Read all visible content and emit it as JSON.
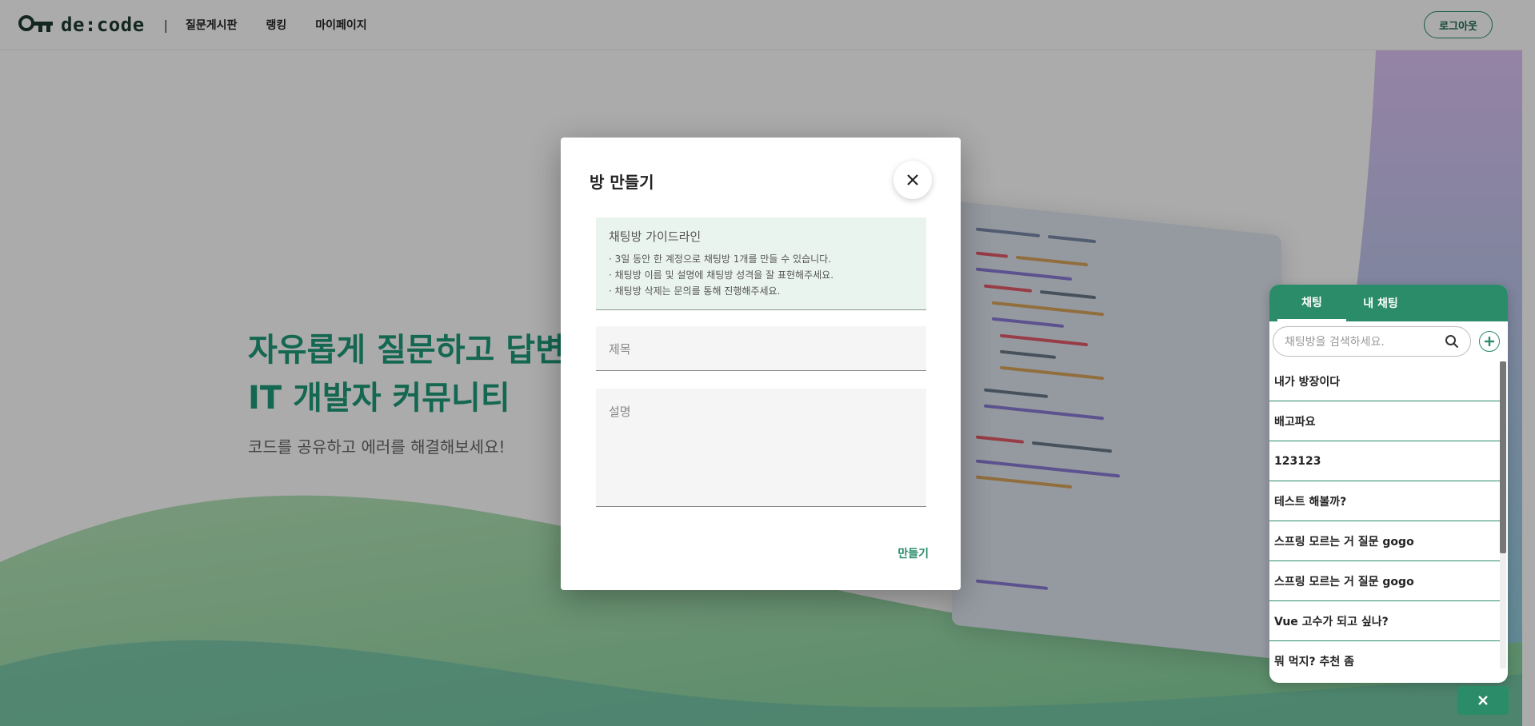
{
  "header": {
    "logo_text": "de:code",
    "nav": [
      "질문게시판",
      "랭킹",
      "마이페이지"
    ],
    "logout_label": "로그아웃"
  },
  "hero": {
    "title_line1": "자유롭게 질문하고 답변",
    "title_line2": "IT 개발자 커뮤니티",
    "subtitle": "코드를 공유하고 에러를 해결해보세요!"
  },
  "modal": {
    "title": "방 만들기",
    "guide_title": "채팅방 가이드라인",
    "guide_lines": [
      "· 3일 동안 한 계정으로 채팅방 1개를 만들 수 있습니다.",
      "· 채팅방 이름 및 설명에 채팅방 성격을 잘 표현해주세요.",
      "· 채팅방 삭제는 문의를 통해 진행해주세요."
    ],
    "title_placeholder": "제목",
    "desc_placeholder": "설명",
    "create_label": "만들기"
  },
  "chat": {
    "tabs": [
      "채팅",
      "내 채팅"
    ],
    "search_placeholder": "채팅방을 검색하세요.",
    "rooms": [
      "내가 방장이다",
      "배고파요",
      "123123",
      "테스트 해볼까?",
      "스프링 모르는 거 질문 gogo",
      "스프링 모르는 거 질문 gogo",
      "Vue 고수가 되고 싶나?",
      "뭐 먹지? 추천 좀"
    ]
  },
  "colors": {
    "brand": "#2b8c6a",
    "hero_title": "#1e9a78",
    "guide_bg": "#eaf4ef"
  }
}
